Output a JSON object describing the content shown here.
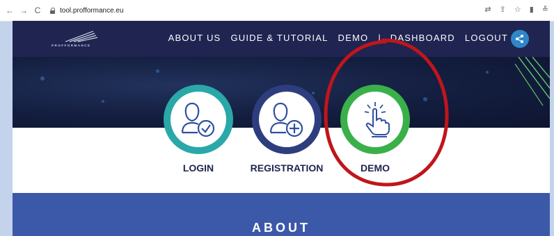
{
  "browser": {
    "url": "tool.profformance.eu",
    "back_icon": "←",
    "forward_icon": "→",
    "reload_icon": "C",
    "right_icons": [
      "translate-icon",
      "share-icon",
      "star-icon",
      "sidebar-icon",
      "profile-icon"
    ]
  },
  "site": {
    "logo_text": "PROFFORMANCE",
    "nav": {
      "about": "ABOUT US",
      "guide": "GUIDE & TUTORIAL",
      "demo": "DEMO",
      "separator": "|",
      "dashboard": "DASHBOARD",
      "logout": "LOGOUT"
    }
  },
  "actions": {
    "login": "LOGIN",
    "registration": "REGISTRATION",
    "demo": "DEMO"
  },
  "about": {
    "title": "ABOUT"
  },
  "colors": {
    "header": "#1f2451",
    "login_ring": "#2aa8a8",
    "registration_ring": "#2e3d7e",
    "demo_ring": "#3ab04a",
    "about_band": "#3c58a8",
    "annotation": "#c0151b",
    "share_button": "#2f86c8"
  }
}
